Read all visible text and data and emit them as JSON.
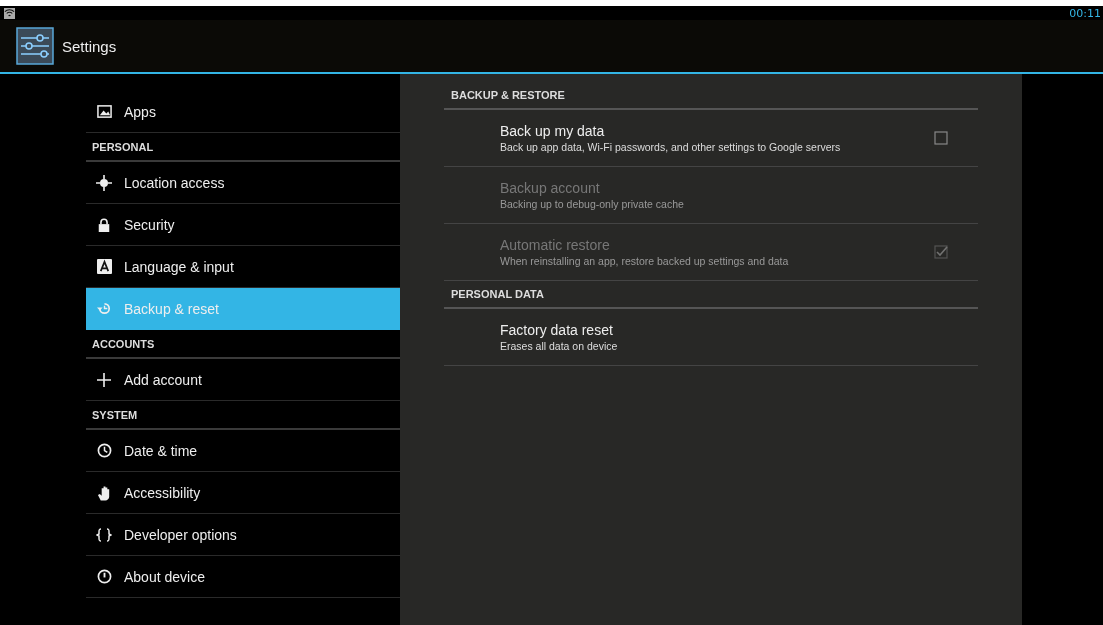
{
  "status_bar": {
    "time": "00:11"
  },
  "action_bar": {
    "title": "Settings"
  },
  "sidebar": {
    "items": [
      {
        "kind": "item",
        "label": "Apps",
        "selected": false
      },
      {
        "kind": "header",
        "label": "PERSONAL"
      },
      {
        "kind": "item",
        "label": "Location access",
        "selected": false
      },
      {
        "kind": "item",
        "label": "Security",
        "selected": false
      },
      {
        "kind": "item",
        "label": "Language & input",
        "selected": false
      },
      {
        "kind": "item",
        "label": "Backup & reset",
        "selected": true
      },
      {
        "kind": "header",
        "label": "ACCOUNTS"
      },
      {
        "kind": "item",
        "label": "Add account",
        "selected": false
      },
      {
        "kind": "header",
        "label": "SYSTEM"
      },
      {
        "kind": "item",
        "label": "Date & time",
        "selected": false
      },
      {
        "kind": "item",
        "label": "Accessibility",
        "selected": false
      },
      {
        "kind": "item",
        "label": "Developer options",
        "selected": false
      },
      {
        "kind": "item",
        "label": "About device",
        "selected": false
      }
    ]
  },
  "content": {
    "sections": [
      {
        "title": "BACKUP & RESTORE",
        "preferences": [
          {
            "kind": "checkbox",
            "title": "Back up my data",
            "summary": "Back up app data, Wi-Fi passwords, and other settings to Google servers",
            "disabled": false,
            "checked": false
          },
          {
            "kind": "plain",
            "title": "Backup account",
            "summary": "Backing up to debug-only private cache",
            "disabled": true
          },
          {
            "kind": "checkbox",
            "title": "Automatic restore",
            "summary": "When reinstalling an app, restore backed up settings and data",
            "disabled": true,
            "checked": true
          }
        ]
      },
      {
        "title": "PERSONAL DATA",
        "preferences": [
          {
            "kind": "plain",
            "title": "Factory data reset",
            "summary": "Erases all data on device",
            "disabled": false
          }
        ]
      }
    ]
  }
}
